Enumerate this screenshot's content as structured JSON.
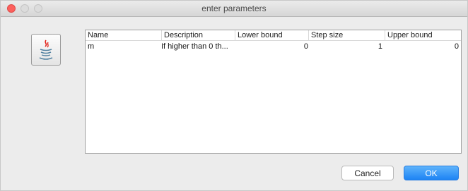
{
  "window": {
    "title": "enter parameters"
  },
  "icons": {
    "app_icon": "java-icon"
  },
  "table": {
    "columns": [
      "Name",
      "Description",
      "Lower bound",
      "Step size",
      "Upper bound"
    ],
    "rows": [
      {
        "name": "m",
        "description": "If higher than 0 th...",
        "lower_bound": "0",
        "step_size": "1",
        "upper_bound": "0"
      }
    ]
  },
  "buttons": {
    "cancel": "Cancel",
    "ok": "OK"
  },
  "colors": {
    "close_button": "#fc605c",
    "primary_button": "#1d83f4"
  }
}
